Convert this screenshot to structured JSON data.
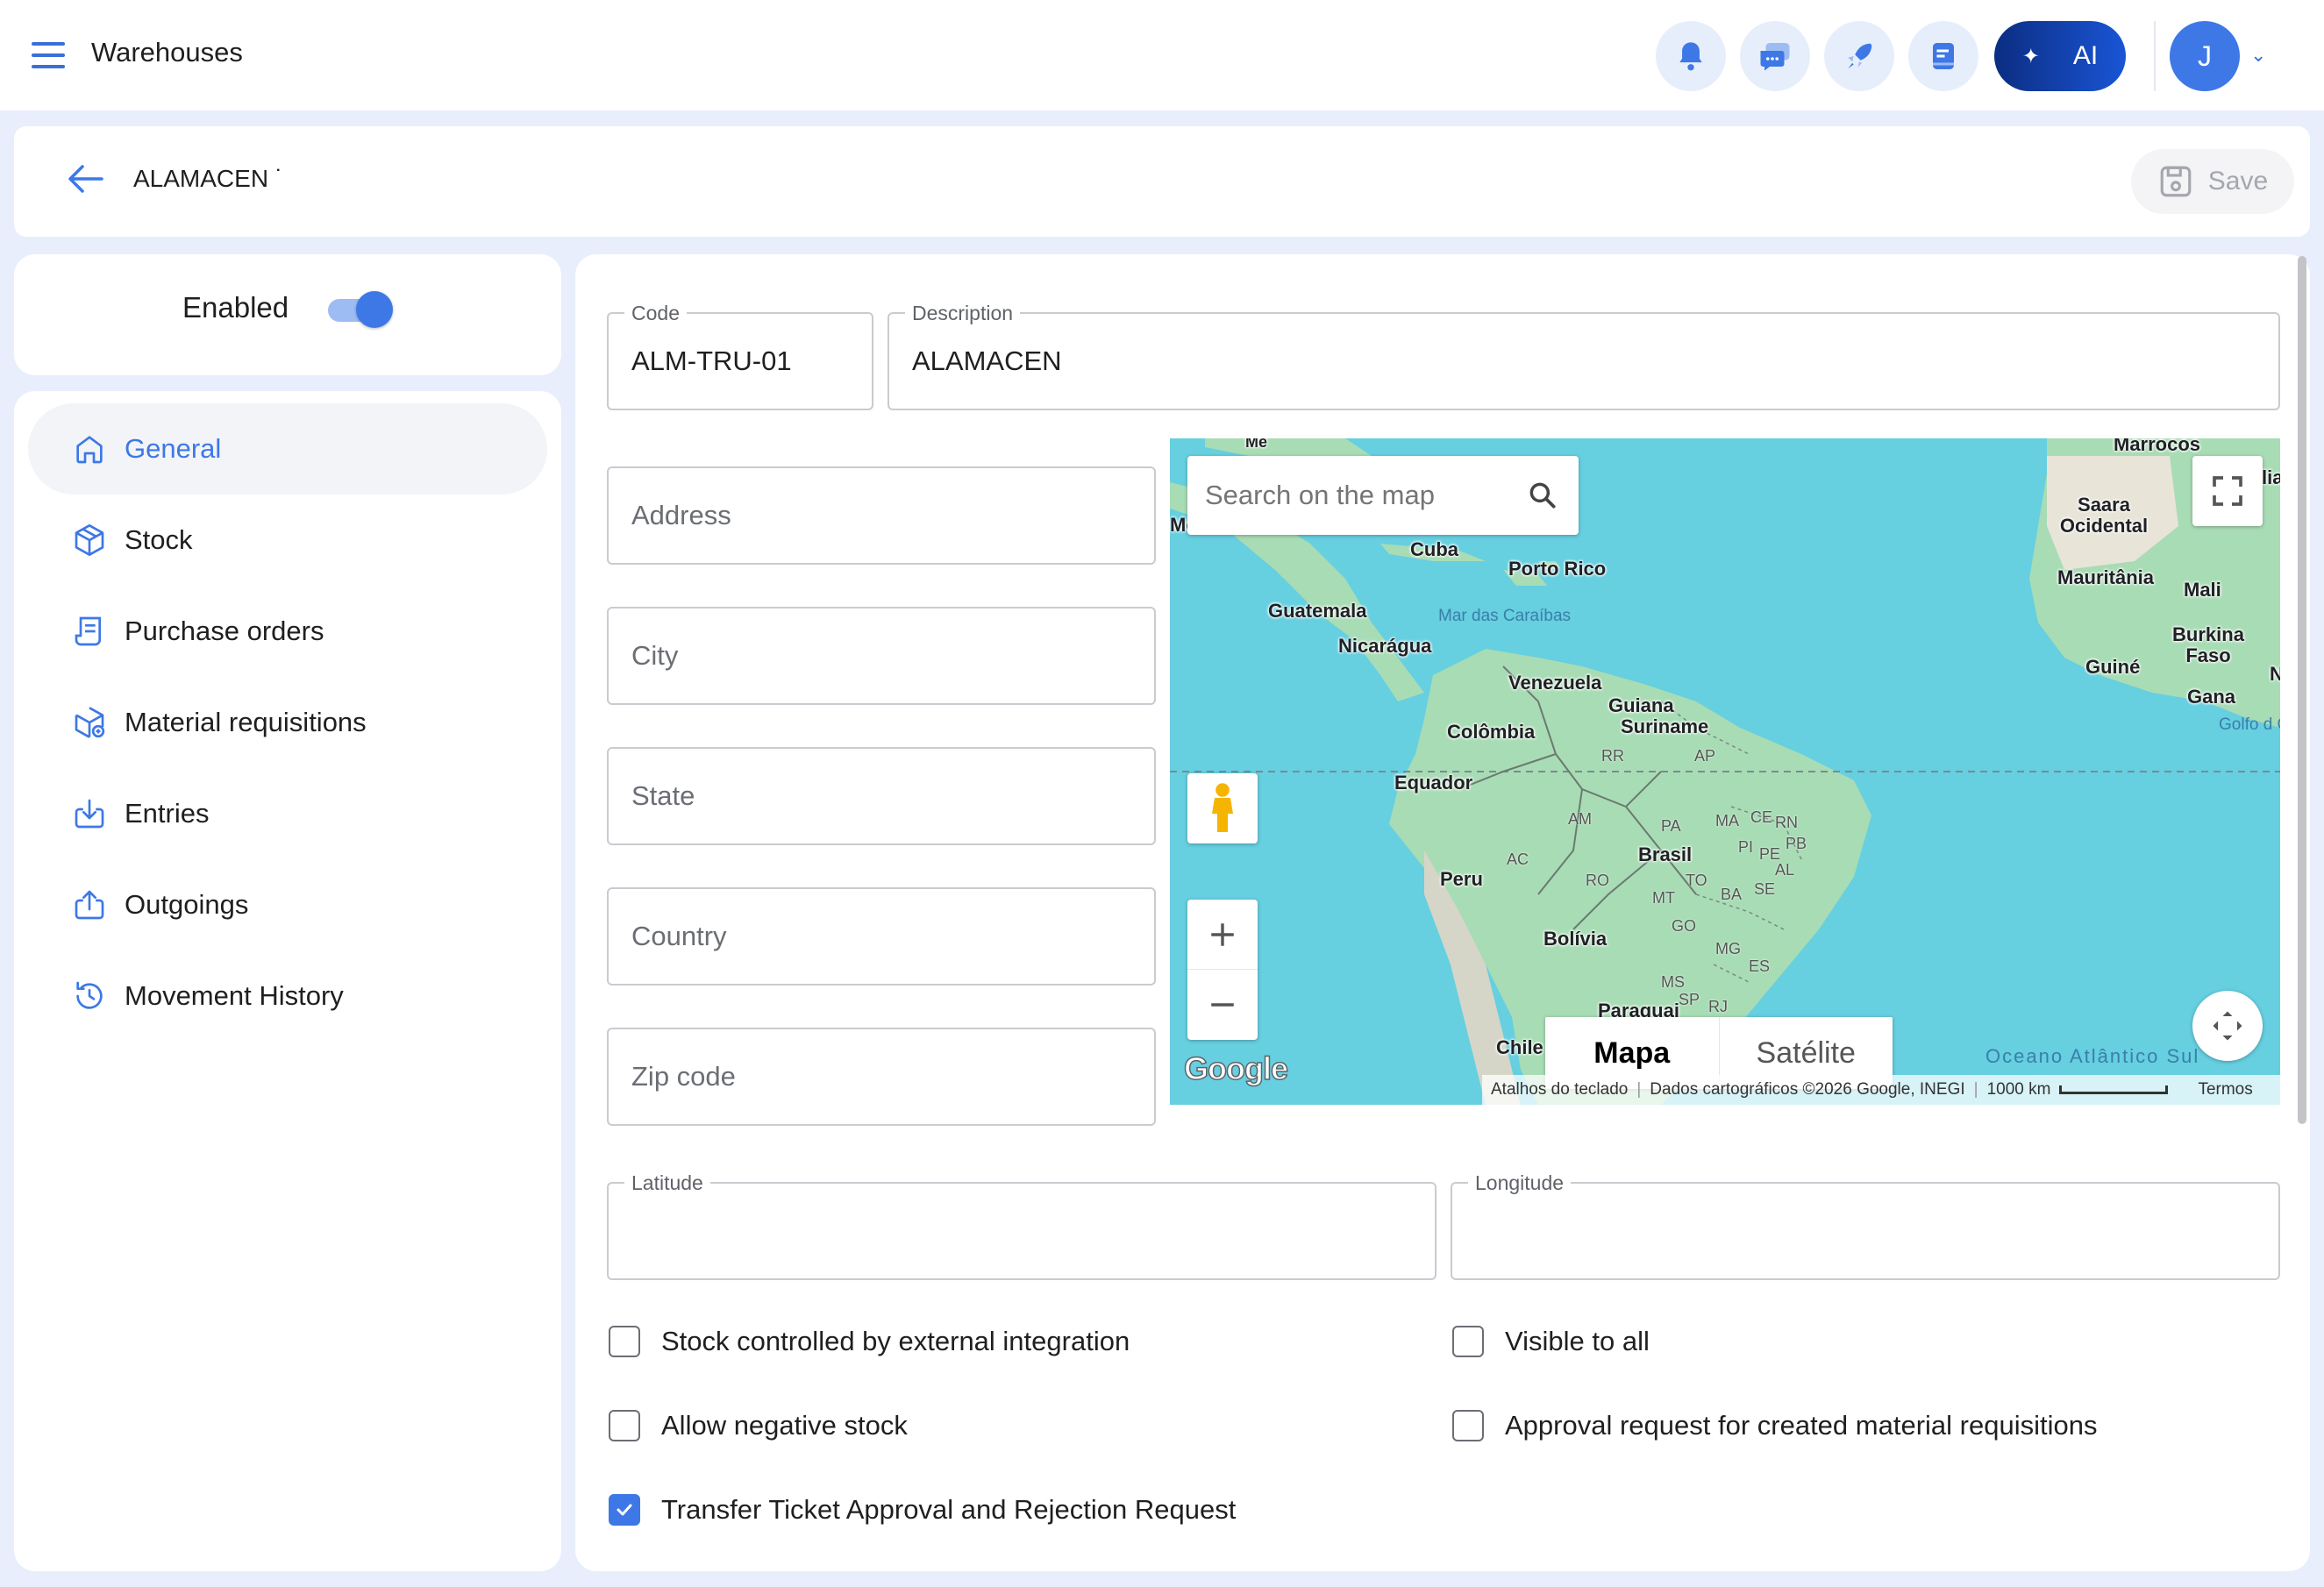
{
  "app": {
    "title": "Warehouses"
  },
  "topbar": {
    "icons": [
      "bell-icon",
      "chat-icon",
      "rocket-icon",
      "notes-icon"
    ],
    "ai_label": "AI",
    "avatar_initial": "J"
  },
  "header": {
    "record_title": "ALAMACEN ˙",
    "save_label": "Save"
  },
  "status": {
    "enabled_label": "Enabled",
    "enabled": true
  },
  "nav": {
    "items": [
      {
        "label": "General",
        "icon": "home-icon",
        "active": true
      },
      {
        "label": "Stock",
        "icon": "box-icon",
        "active": false
      },
      {
        "label": "Purchase orders",
        "icon": "purchase-order-icon",
        "active": false
      },
      {
        "label": "Material requisitions",
        "icon": "material-requisition-icon",
        "active": false
      },
      {
        "label": "Entries",
        "icon": "download-icon",
        "active": false
      },
      {
        "label": "Outgoings",
        "icon": "upload-icon",
        "active": false
      },
      {
        "label": "Movement History",
        "icon": "history-icon",
        "active": false
      }
    ]
  },
  "form": {
    "code": {
      "label": "Code",
      "value": "ALM-TRU-01"
    },
    "description": {
      "label": "Description",
      "value": "ALAMACEN"
    },
    "address": {
      "placeholder": "Address",
      "value": ""
    },
    "city": {
      "placeholder": "City",
      "value": ""
    },
    "state": {
      "placeholder": "State",
      "value": ""
    },
    "country": {
      "placeholder": "Country",
      "value": ""
    },
    "zip": {
      "placeholder": "Zip code",
      "value": ""
    },
    "latitude": {
      "label": "Latitude",
      "value": ""
    },
    "longitude": {
      "label": "Longitude",
      "value": ""
    }
  },
  "map": {
    "search_placeholder": "Search on the map",
    "type_map": "Mapa",
    "type_satellite": "Satélite",
    "logo": "Google",
    "footer": {
      "shortcuts": "Atalhos do teclado",
      "data": "Dados cartográficos ©2026 Google, INEGI",
      "scale": "1000 km",
      "terms": "Termos"
    },
    "labels": {
      "cuba": "Cuba",
      "puerto_rico": "Porto Rico",
      "guatemala": "Guatemala",
      "nicaragua": "Nicarágua",
      "caribbean": "Mar das Caraíbas",
      "venezuela": "Venezuela",
      "guiana": "Guiana",
      "suriname": "Suriname",
      "colombia": "Colômbia",
      "ecuador": "Equador",
      "peru": "Peru",
      "brasil": "Brasil",
      "bolivia": "Bolívia",
      "paraguai": "Paraguai",
      "chile": "Chile",
      "saara": "Saara Ocidental",
      "mauritania": "Mauritânia",
      "mali": "Mali",
      "burkina": "Burkina Faso",
      "guine": "Guiné",
      "gana": "Gana",
      "golfo": "Golfo d Guiné",
      "oceano": "Oceano Atlântico Sul",
      "marrocos": "Marrocos",
      "mo": "Mé",
      "lia": "lia",
      "n": "N",
      "states": [
        "RR",
        "AP",
        "AM",
        "PA",
        "MA",
        "CE",
        "RN",
        "PI",
        "PB",
        "PE",
        "AL",
        "AC",
        "RO",
        "TO",
        "SE",
        "BA",
        "MT",
        "GO",
        "MG",
        "ES",
        "MS",
        "SP",
        "RJ"
      ]
    }
  },
  "options": {
    "stock_external": {
      "label": "Stock controlled by external integration",
      "checked": false
    },
    "visible_all": {
      "label": "Visible to all",
      "checked": false
    },
    "allow_negative": {
      "label": "Allow negative stock",
      "checked": false
    },
    "approval_requisitions": {
      "label": "Approval request for created material requisitions",
      "checked": false
    },
    "transfer_ticket": {
      "label": "Transfer Ticket Approval and Rejection Request",
      "checked": true
    }
  },
  "colors": {
    "accent": "#3d78e6",
    "background": "#e8eefb",
    "map_water": "#66cfe0",
    "map_land": "#a8dcb5"
  }
}
